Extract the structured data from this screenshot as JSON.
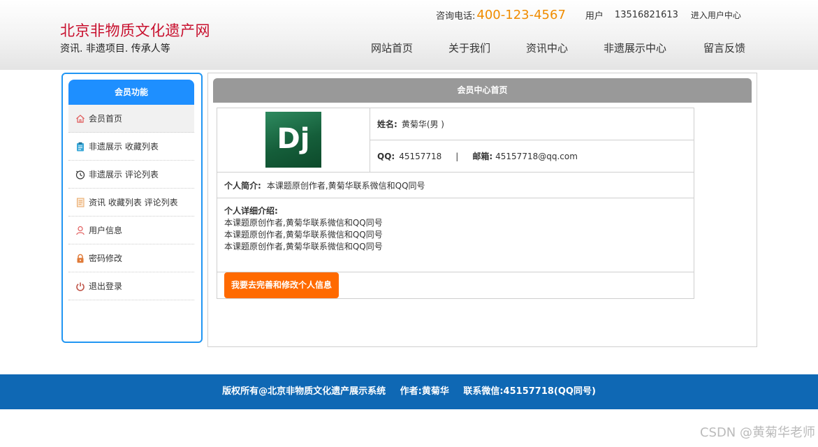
{
  "header": {
    "site_title": "北京非物质文化遗产网",
    "site_subtitle": "资讯. 非遗项目. 传承人等",
    "phone_label": "咨询电话:",
    "phone": "400-123-4567",
    "user_label": "用户",
    "user_id": "13516821613",
    "user_center_link": "进入用户中心",
    "nav": [
      "网站首页",
      "关于我们",
      "资讯中心",
      "非遗展示中心",
      "留言反馈"
    ]
  },
  "sidebar": {
    "title": "会员功能",
    "items": [
      {
        "label": "会员首页",
        "icon": "home-icon"
      },
      {
        "label": "非遗展示 收藏列表",
        "icon": "clipboard-icon"
      },
      {
        "label": "非遗展示 评论列表",
        "icon": "clock-icon"
      },
      {
        "label": "资讯 收藏列表 评论列表",
        "icon": "document-icon"
      },
      {
        "label": "用户信息",
        "icon": "user-icon"
      },
      {
        "label": "密码修改",
        "icon": "lock-icon"
      },
      {
        "label": "退出登录",
        "icon": "power-icon"
      }
    ]
  },
  "main": {
    "title": "会员中心首页",
    "avatar_text": "Dj",
    "name_label": "姓名:",
    "name_value": "黄菊华(男 )",
    "qq_label": "QQ:",
    "qq_value": "45157718",
    "separator": "|",
    "email_label": "邮箱:",
    "email_value": "45157718@qq.com",
    "intro_label": "个人简介:",
    "intro_value": "本课题原创作者,黄菊华联系微信和QQ同号",
    "detail_label": "个人详细介绍:",
    "detail_lines": [
      "本课题原创作者,黄菊华联系微信和QQ同号",
      "本课题原创作者,黄菊华联系微信和QQ同号",
      "本课题原创作者,黄菊华联系微信和QQ同号"
    ],
    "edit_button": "我要去完善和修改个人信息"
  },
  "footer": {
    "copyright": "版权所有@北京非物质文化遗产展示系统",
    "author": "作者:黄菊华",
    "contact": "联系微信:45157718(QQ同号)"
  },
  "watermark": "CSDN @黄菊华老师",
  "colors": {
    "brand_red": "#c8102e",
    "phone_orange": "#f08c00",
    "sidebar_blue": "#1e8fff",
    "footer_blue": "#0f68b4",
    "button_orange": "#ff6a00",
    "panel_gray": "#999999"
  }
}
